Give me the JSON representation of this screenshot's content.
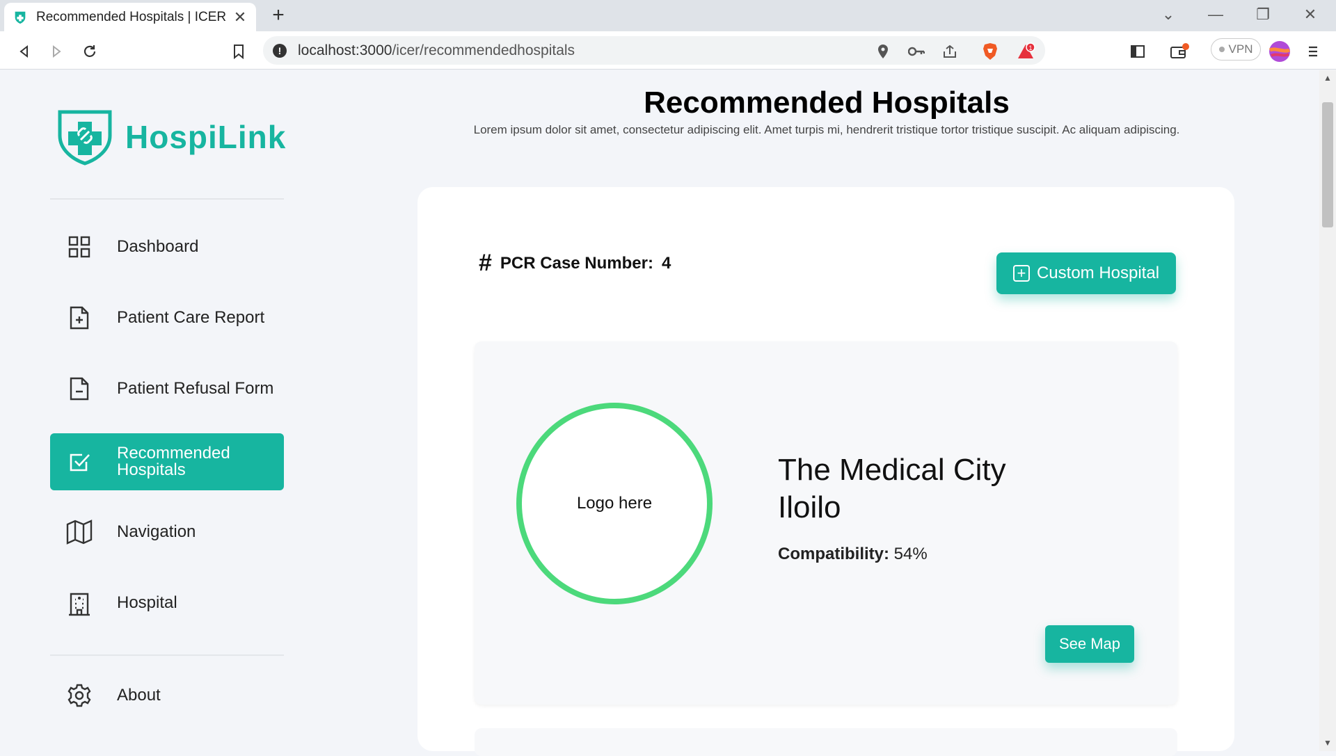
{
  "browser": {
    "tab_title": "Recommended Hospitals | ICER",
    "new_tab": "+",
    "url_host": "localhost:3000",
    "url_path": "/icer/recommendedhospitals",
    "vpn_label": "VPN",
    "notification_badge": "1"
  },
  "sidebar": {
    "brand": "HospiLink",
    "items": [
      {
        "label": "Dashboard",
        "icon": "grid-icon"
      },
      {
        "label": "Patient Care Report",
        "icon": "file-plus-icon"
      },
      {
        "label": "Patient Refusal Form",
        "icon": "file-minus-icon"
      },
      {
        "label": "Recommended Hospitals",
        "icon": "checkbox-icon",
        "active": true
      },
      {
        "label": "Navigation",
        "icon": "map-icon"
      },
      {
        "label": "Hospital",
        "icon": "building-icon"
      },
      {
        "label": "About",
        "icon": "gear-icon"
      }
    ]
  },
  "main": {
    "title": "Recommended Hospitals",
    "subtitle": "Lorem ipsum dolor sit amet, consectetur adipiscing elit. Amet turpis mi, hendrerit tristique tortor tristique suscipit. Ac aliquam adipiscing.",
    "pcr_label": "PCR Case Number:",
    "pcr_number": "4",
    "custom_hospital_label": "Custom Hospital",
    "hospital": {
      "logo_text": "Logo here",
      "name": "The Medical City Iloilo",
      "compat_label": "Compatibility:",
      "compat_value": "54%",
      "see_map_label": "See Map"
    }
  },
  "colors": {
    "accent": "#17b5a0",
    "ring": "#4cd97b",
    "background": "#f3f5f9"
  }
}
